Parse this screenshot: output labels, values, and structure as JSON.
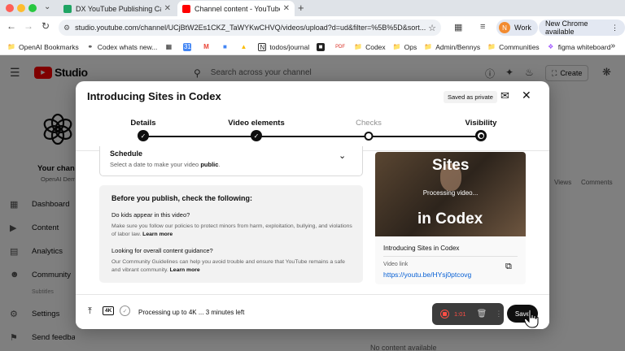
{
  "browser": {
    "tabs": [
      {
        "title": "DX YouTube Publishing Calen",
        "favicon_color": "#1fa463"
      },
      {
        "title": "Channel content - YouTube St",
        "favicon_color": "#ff0000"
      }
    ],
    "url": "studio.youtube.com/channel/UCjBtW2Es1CKZ_TaWYKwCHVQ/videos/upload?d=ud&filter=%5B%5D&sort...",
    "profile_initial": "N",
    "profile_label": "Work",
    "update_label": "New Chrome available",
    "bookmarks": [
      {
        "label": "OpenAI Bookmarks",
        "icon": "folder-icon"
      },
      {
        "label": "Codex whats new...",
        "icon": "link-icon"
      },
      {
        "label": "",
        "icon": "grid-icon"
      },
      {
        "label": "",
        "icon": "calendar-icon"
      },
      {
        "label": "",
        "icon": "gmail-icon"
      },
      {
        "label": "",
        "icon": "bookmark-icon"
      },
      {
        "label": "",
        "icon": "drive-icon"
      },
      {
        "label": "todos/journal",
        "icon": "notion-icon"
      },
      {
        "label": "",
        "icon": "app-icon"
      },
      {
        "label": "",
        "icon": "pdf-icon"
      },
      {
        "label": "Codex",
        "icon": "folder-icon"
      },
      {
        "label": "Ops",
        "icon": "folder-icon"
      },
      {
        "label": "Admin/Bennys",
        "icon": "folder-icon"
      },
      {
        "label": "Communities",
        "icon": "folder-icon"
      },
      {
        "label": "figma whiteboard",
        "icon": "figma-icon"
      }
    ]
  },
  "studio": {
    "logo_text": "Studio",
    "search_placeholder": "Search across your channel",
    "create_label": "Create",
    "channel_name": "Your chann",
    "channel_sub": "OpenAI Dem",
    "nav": [
      {
        "label": "Dashboard",
        "icon": "dashboard-icon"
      },
      {
        "label": "Content",
        "icon": "content-icon"
      },
      {
        "label": "Analytics",
        "icon": "analytics-icon"
      },
      {
        "label": "Community",
        "icon": "community-icon"
      },
      {
        "label": "Subtitles",
        "icon": "subtitles-icon"
      },
      {
        "label": "Settings",
        "icon": "gear-icon"
      },
      {
        "label": "Send feedback",
        "icon": "feedback-icon"
      }
    ],
    "columns": [
      "Views",
      "Comments"
    ],
    "empty_text": "No content available"
  },
  "dialog": {
    "title": "Introducing Sites in Codex",
    "saved_badge": "Saved as private",
    "steps": [
      {
        "label": "Details",
        "state": "done"
      },
      {
        "label": "Video elements",
        "state": "done"
      },
      {
        "label": "Checks",
        "state": "pending"
      },
      {
        "label": "Visibility",
        "state": "current"
      }
    ],
    "schedule": {
      "title": "Schedule",
      "subtitle_pre": "Select a date to make your video ",
      "subtitle_bold": "public",
      "subtitle_post": "."
    },
    "prepublish": {
      "heading": "Before you publish, check the following:",
      "q1": "Do kids appear in this video?",
      "p1": "Make sure you follow our policies to protect minors from harm, exploitation, bullying, and violations of labor law.",
      "p1_link": "Learn more",
      "q2": "Looking for overall content guidance?",
      "p2": "Our Community Guidelines can help you avoid trouble and ensure that YouTube remains a safe and vibrant community.",
      "p2_link": "Learn more"
    },
    "preview": {
      "thumb_top": "Sites",
      "thumb_status": "Processing video...",
      "thumb_bottom": "in Codex",
      "video_title": "Introducing Sites in Codex",
      "link_label": "Video link",
      "link": "https://youtu.be/HYsj0ptcovg"
    },
    "footer": {
      "badge_4k": "4K",
      "status": "Processing up to 4K ... 3 minutes left",
      "rec_time": "1:01",
      "save_label": "Save"
    }
  }
}
